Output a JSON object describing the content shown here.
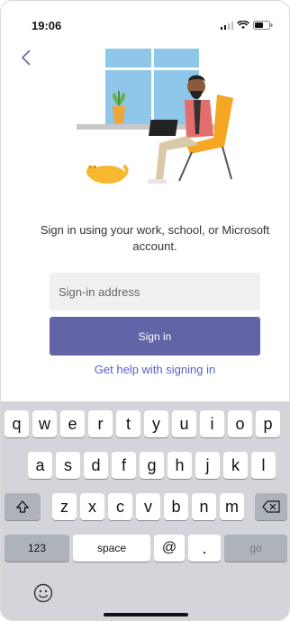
{
  "status": {
    "time": "19:06"
  },
  "signin": {
    "message": "Sign in using your work, school, or Microsoft account.",
    "address_placeholder": "Sign-in address",
    "button_label": "Sign in",
    "help_link": "Get help with signing in"
  },
  "keyboard": {
    "row1": [
      "q",
      "w",
      "e",
      "r",
      "t",
      "y",
      "u",
      "i",
      "o",
      "p"
    ],
    "row2": [
      "a",
      "s",
      "d",
      "f",
      "g",
      "h",
      "j",
      "k",
      "l"
    ],
    "row3": [
      "z",
      "x",
      "c",
      "v",
      "b",
      "n",
      "m"
    ],
    "numbers_key": "123",
    "space_key": "space",
    "at_key": "@",
    "dot_key": ".",
    "go_key": "go"
  },
  "colors": {
    "accent": "#6264a7",
    "link": "#5b5fc7",
    "keyboard_bg": "#d3d5db"
  },
  "icons": {
    "back": "chevron-left-icon",
    "shift": "shift-icon",
    "delete": "backspace-icon",
    "emoji": "emoji-icon"
  }
}
